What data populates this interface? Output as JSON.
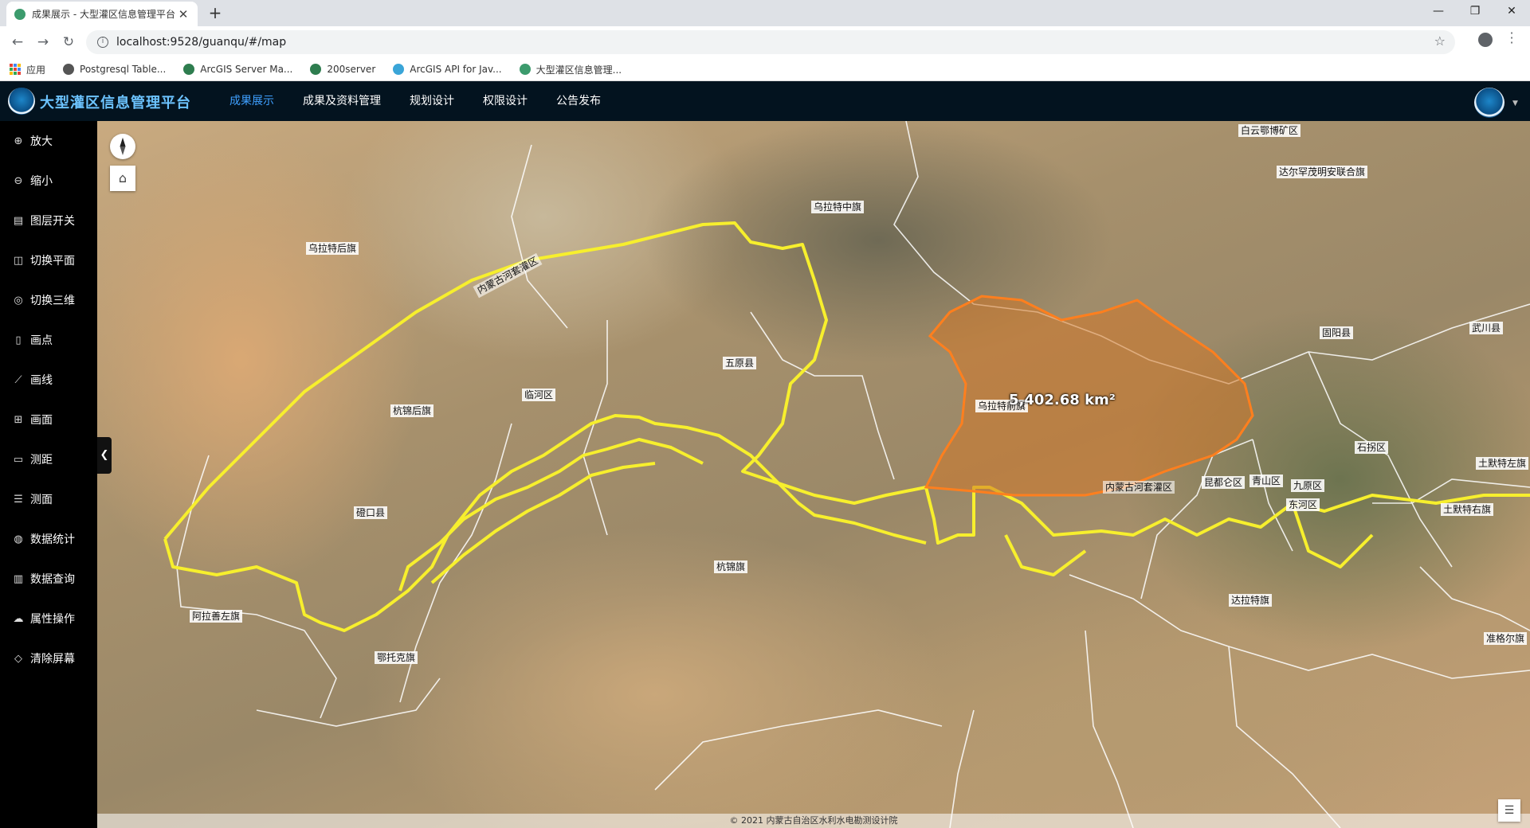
{
  "browser": {
    "tab_title": "成果展示 - 大型灌区信息管理平台",
    "url": "localhost:9528/guanqu/#/map",
    "bookmarks": [
      {
        "label": "应用",
        "icon": "apps-grid-icon"
      },
      {
        "label": "Postgresql Table...",
        "icon": "bookmark-globe-icon"
      },
      {
        "label": "ArcGIS Server Ma...",
        "icon": "arcgis-globe-icon"
      },
      {
        "label": "200server",
        "icon": "arcgis-globe-icon"
      },
      {
        "label": "ArcGIS API for Jav...",
        "icon": "arcgis-api-icon"
      },
      {
        "label": "大型灌区信息管理...",
        "icon": "site-favicon-icon"
      }
    ]
  },
  "app": {
    "title": "大型灌区信息管理平台",
    "nav": [
      {
        "label": "成果展示",
        "active": true
      },
      {
        "label": "成果及资料管理",
        "active": false
      },
      {
        "label": "规划设计",
        "active": false
      },
      {
        "label": "权限设计",
        "active": false
      },
      {
        "label": "公告发布",
        "active": false
      }
    ]
  },
  "tools": [
    {
      "label": "放大",
      "icon": "zoom-in-icon"
    },
    {
      "label": "缩小",
      "icon": "zoom-out-icon"
    },
    {
      "label": "图层开关",
      "icon": "layers-icon"
    },
    {
      "label": "切换平面",
      "icon": "map-2d-icon"
    },
    {
      "label": "切换三维",
      "icon": "globe-3d-icon"
    },
    {
      "label": "画点",
      "icon": "draw-point-icon"
    },
    {
      "label": "画线",
      "icon": "draw-line-icon"
    },
    {
      "label": "画面",
      "icon": "draw-polygon-icon"
    },
    {
      "label": "测距",
      "icon": "measure-distance-icon"
    },
    {
      "label": "测面",
      "icon": "measure-area-icon"
    },
    {
      "label": "数据统计",
      "icon": "statistics-icon"
    },
    {
      "label": "数据查询",
      "icon": "bar-chart-icon"
    },
    {
      "label": "属性操作",
      "icon": "cloud-upload-icon"
    },
    {
      "label": "清除屏幕",
      "icon": "eraser-icon"
    }
  ],
  "map": {
    "area_measure": "5,402.68 km²",
    "places": [
      "白云鄂博矿区",
      "达尔罕茂明安联合旗",
      "乌拉特中旗",
      "乌拉特后旗",
      "内蒙古河套灌区",
      "五原县",
      "临河区",
      "杭锦后旗",
      "磴口县",
      "乌拉特前旗",
      "固阳县",
      "武川县",
      "石拐区",
      "土默特左旗",
      "昆都仑区",
      "青山区",
      "九原区",
      "东河区",
      "土默特右旗",
      "内蒙古河套灌区",
      "杭锦旗",
      "达拉特旗",
      "阿拉善左旗",
      "鄂托克旗",
      "准格尔旗"
    ],
    "attribution": "© 2021 内蒙古自治区水利水电勘测设计院",
    "colors": {
      "irrigation_boundary": "#f7ef2d",
      "measure_polygon": "#ff7f1e",
      "admin_boundary": "#ffffff"
    }
  }
}
